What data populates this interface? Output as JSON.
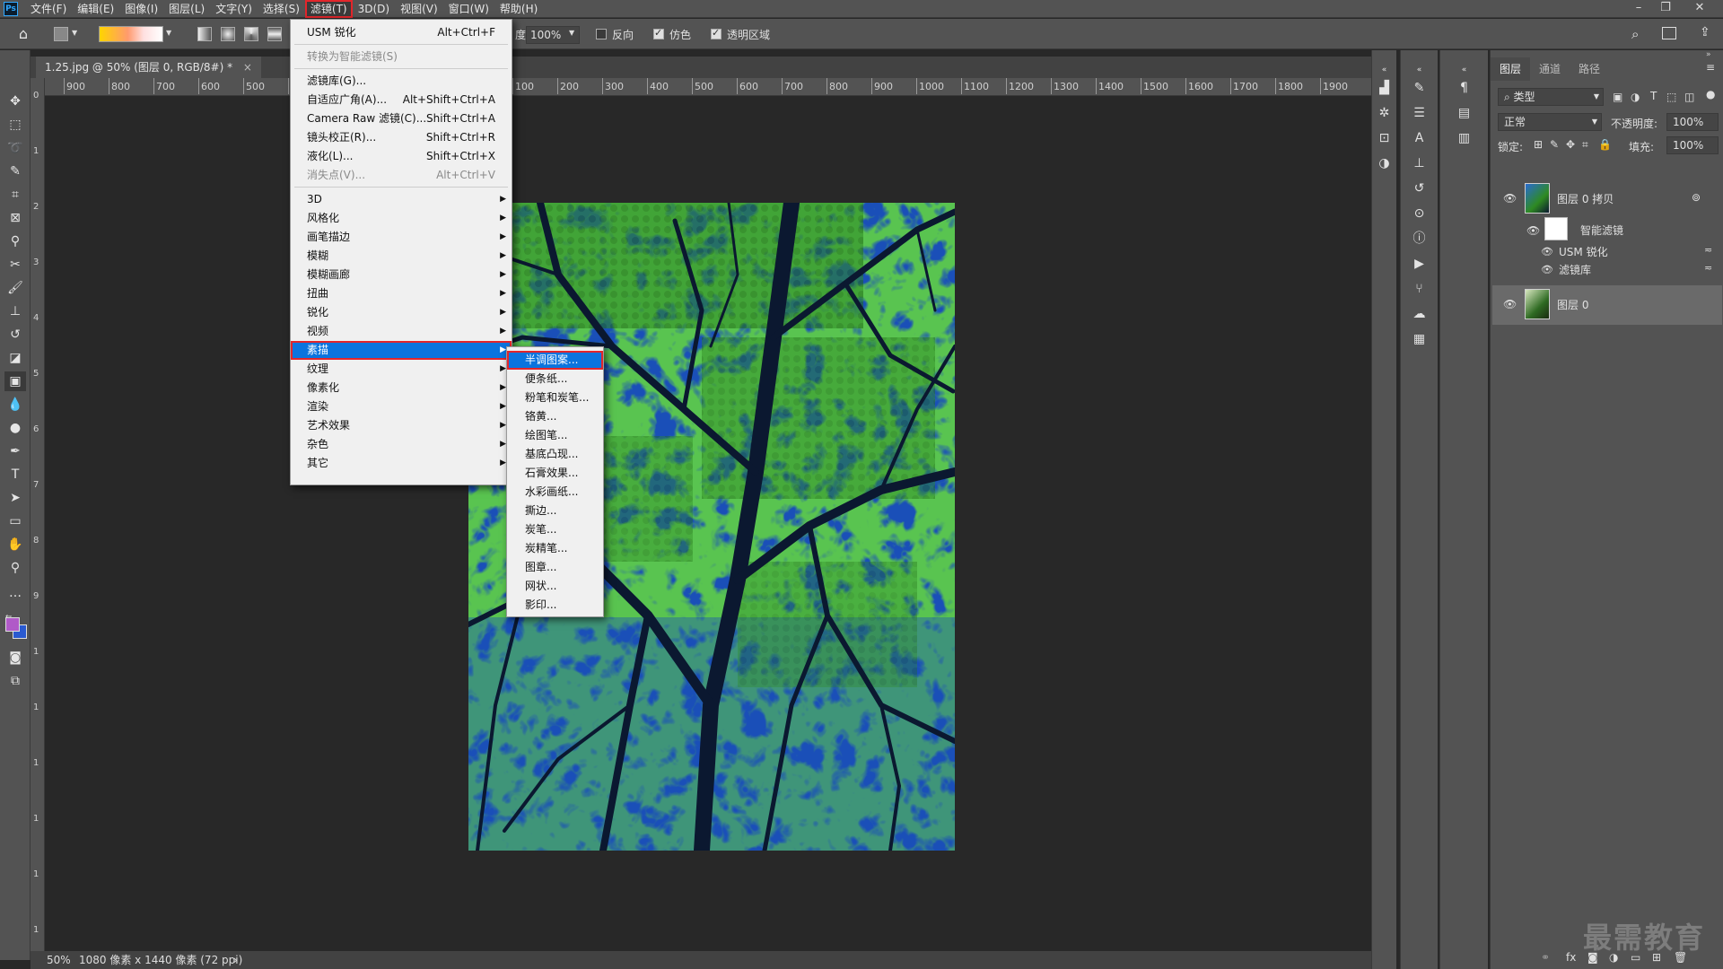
{
  "app": {
    "logo": "Ps"
  },
  "menubar": {
    "items": [
      "文件(F)",
      "编辑(E)",
      "图像(I)",
      "图层(L)",
      "文字(Y)",
      "选择(S)",
      "滤镜(T)",
      "3D(D)",
      "视图(V)",
      "窗口(W)",
      "帮助(H)"
    ],
    "active_index": 6,
    "window_controls": [
      "minimize-icon",
      "restore-icon",
      "close-icon"
    ]
  },
  "options": {
    "zoom_prefix": "度:",
    "opacity": "100%",
    "reverse": "反向",
    "dither": "仿色",
    "transparency": "透明区域",
    "reverse_checked": false,
    "dither_checked": true,
    "transparency_checked": true
  },
  "document": {
    "tab_title": "1.25.jpg @ 50% (图层 0, RGB/8#) *",
    "close": "×"
  },
  "rulers": {
    "h_ticks": [
      "900",
      "800",
      "700",
      "600",
      "500",
      "400",
      "300",
      "200",
      "100",
      "0",
      "100",
      "200",
      "300",
      "400",
      "500",
      "600",
      "700",
      "800",
      "900",
      "1000",
      "1100",
      "1200",
      "1300",
      "1400",
      "1500",
      "1600",
      "1700",
      "1800",
      "1900"
    ],
    "v_ticks": [
      "0",
      "1",
      "2",
      "3",
      "4",
      "5",
      "6",
      "7",
      "8",
      "9",
      "1",
      "1",
      "1",
      "1",
      "1",
      "1"
    ]
  },
  "status": {
    "zoom": "50%",
    "info": "1080 像素 x 1440 像素 (72 ppi)",
    "arrow": "›"
  },
  "filter_menu": {
    "items": [
      {
        "label": "USM 锐化",
        "shortcut": "Alt+Ctrl+F"
      },
      {
        "sep": true
      },
      {
        "label": "转换为智能滤镜(S)",
        "disabled": true
      },
      {
        "sep": true
      },
      {
        "label": "滤镜库(G)..."
      },
      {
        "label": "自适应广角(A)...",
        "shortcut": "Alt+Shift+Ctrl+A"
      },
      {
        "label": "Camera Raw 滤镜(C)...",
        "shortcut": "Shift+Ctrl+A"
      },
      {
        "label": "镜头校正(R)...",
        "shortcut": "Shift+Ctrl+R"
      },
      {
        "label": "液化(L)...",
        "shortcut": "Shift+Ctrl+X"
      },
      {
        "label": "消失点(V)...",
        "shortcut": "Alt+Ctrl+V",
        "disabled": true
      },
      {
        "sep": true
      },
      {
        "label": "3D",
        "sub": true
      },
      {
        "label": "风格化",
        "sub": true
      },
      {
        "label": "画笔描边",
        "sub": true
      },
      {
        "label": "模糊",
        "sub": true
      },
      {
        "label": "模糊画廊",
        "sub": true
      },
      {
        "label": "扭曲",
        "sub": true
      },
      {
        "label": "锐化",
        "sub": true
      },
      {
        "label": "视频",
        "sub": true
      },
      {
        "label": "素描",
        "sub": true,
        "highlight": true
      },
      {
        "label": "纹理",
        "sub": true
      },
      {
        "label": "像素化",
        "sub": true
      },
      {
        "label": "渲染",
        "sub": true
      },
      {
        "label": "艺术效果",
        "sub": true
      },
      {
        "label": "杂色",
        "sub": true
      },
      {
        "label": "其它",
        "sub": true
      }
    ]
  },
  "sketch_submenu": {
    "items": [
      "半调图案...",
      "便条纸...",
      "粉笔和炭笔...",
      "铬黄...",
      "绘图笔...",
      "基底凸现...",
      "石膏效果...",
      "水彩画纸...",
      "撕边...",
      "炭笔...",
      "炭精笔...",
      "图章...",
      "网状...",
      "影印..."
    ],
    "highlight_index": 0
  },
  "layers_panel": {
    "tabs": [
      "图层",
      "通道",
      "路径"
    ],
    "active_tab": 0,
    "filter_kind": "类型",
    "blend_mode": "正常",
    "opacity_label": "不透明度:",
    "opacity": "100%",
    "lock_label": "锁定:",
    "fill_label": "填充:",
    "fill": "100%",
    "layers": [
      {
        "name": "图层 0 拷贝",
        "smart_filters_label": "智能滤镜",
        "filters": [
          "USM 锐化",
          "滤镜库"
        ]
      },
      {
        "name": "图层 0",
        "selected": true
      }
    ]
  },
  "colors": {
    "menubar": "#535353",
    "panel": "#535353",
    "canvas": "#282828",
    "highlight": "#0b74de",
    "outline_red": "#e3262b",
    "foreground": "#b05ac8",
    "background": "#2a5ad0"
  },
  "watermark": "最需教育"
}
